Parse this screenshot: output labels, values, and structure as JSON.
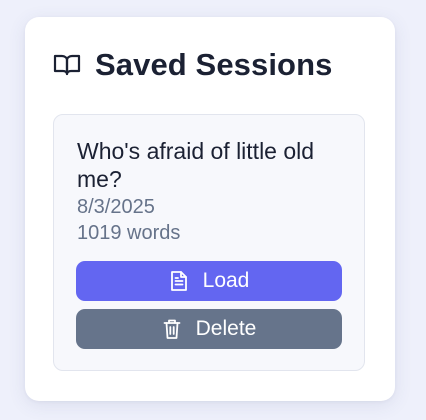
{
  "panel": {
    "title": "Saved Sessions",
    "icon": "book-open-icon"
  },
  "sessions": [
    {
      "title": "Who's afraid of little old me?",
      "date": "8/3/2025",
      "word_count": "1019 words",
      "load_label": "Load",
      "load_icon": "file-text-icon",
      "delete_label": "Delete",
      "delete_icon": "trash-icon"
    }
  ],
  "colors": {
    "background": "#eef0fb",
    "load_button": "#6366f1",
    "delete_button": "#66748b",
    "title_text": "#1b2133",
    "meta_text": "#66738a"
  }
}
